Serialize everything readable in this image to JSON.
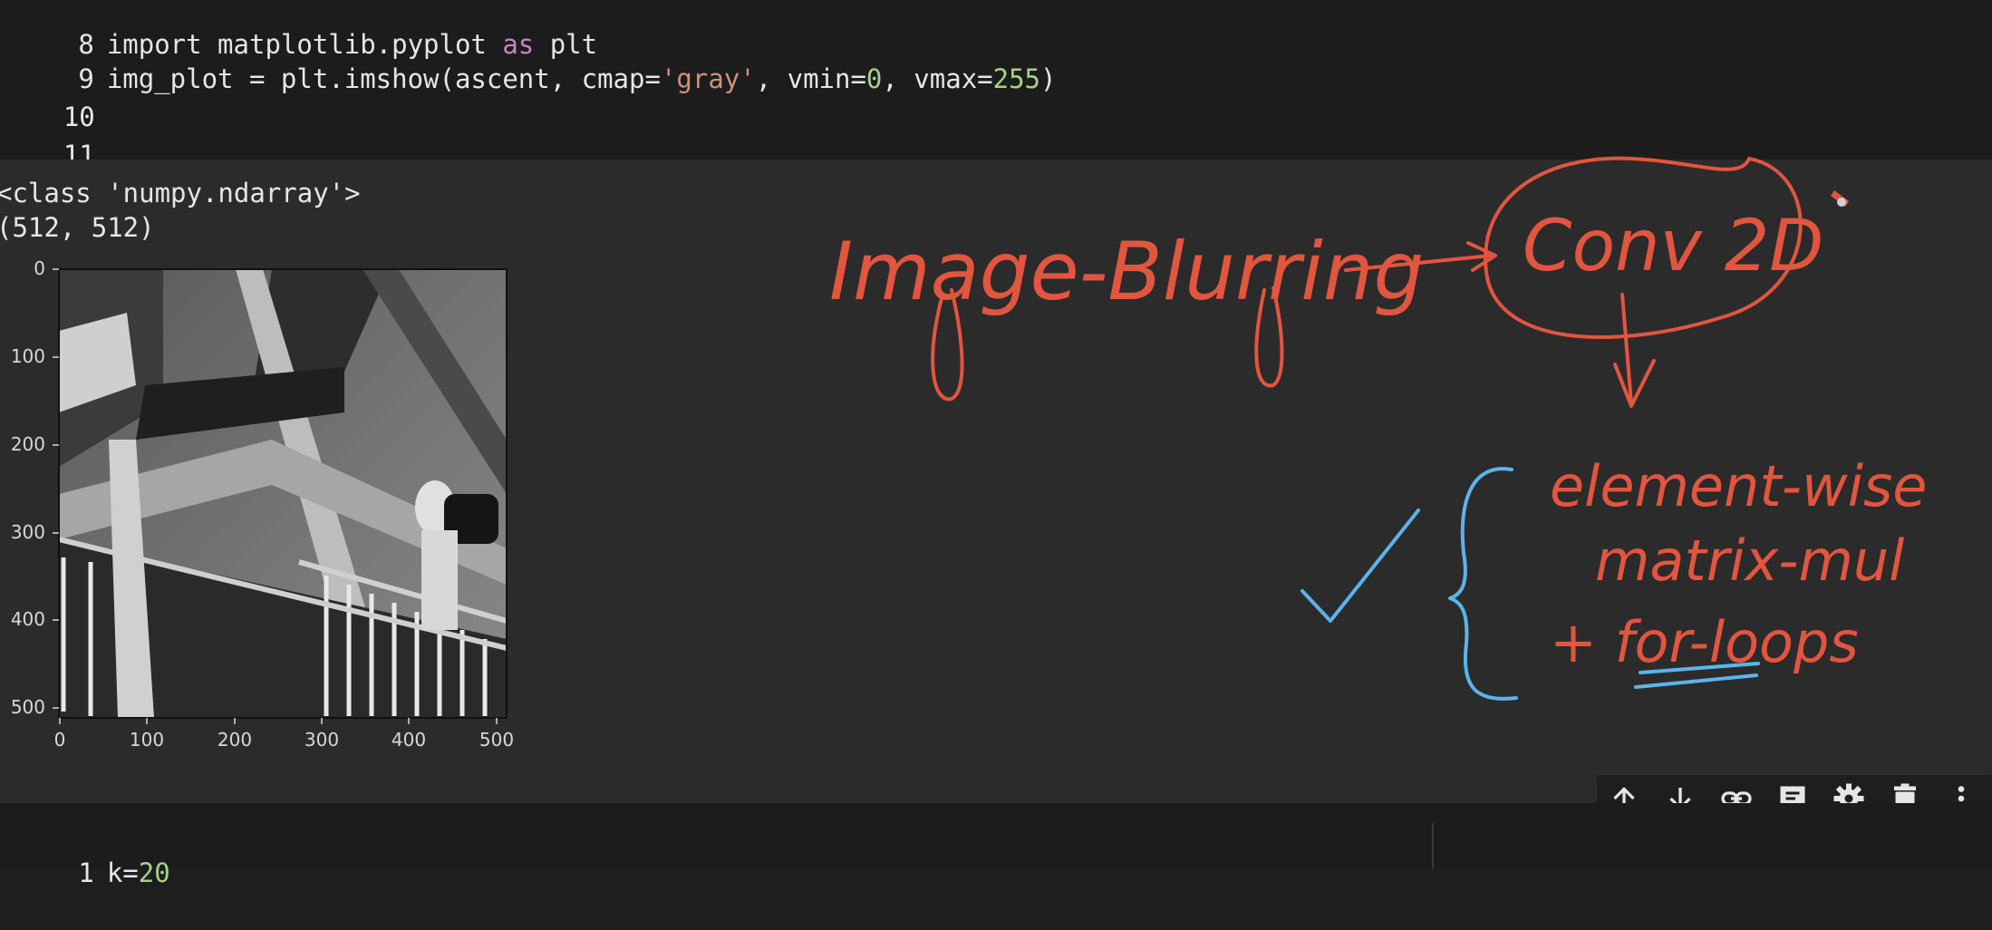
{
  "code_cell": {
    "lines": [
      {
        "num": "8",
        "text_a": "import matplotlib.pyplot ",
        "text_b": "as",
        "text_c": " plt"
      },
      {
        "num": "9",
        "text_a": "img_plot = plt.imshow(ascent, cmap=",
        "str": "'gray'",
        "text_b": ", vmin=",
        "n1": "0",
        "text_c": ", vmax=",
        "n2": "255",
        "text_d": ")"
      },
      {
        "num": "10"
      },
      {
        "num": "11"
      }
    ]
  },
  "output": {
    "line1": "<class 'numpy.ndarray'>",
    "line2": "(512, 512)"
  },
  "plot": {
    "yticks": [
      "0",
      "100",
      "200",
      "300",
      "400",
      "500"
    ],
    "xticks": [
      "0",
      "100",
      "200",
      "300",
      "400",
      "500"
    ],
    "image_desc_icon": "grayscale-staircase-image"
  },
  "annotations": {
    "image_blurring": "Image-Blurring",
    "conv2d": "Conv 2D",
    "element_wise": "element-wise",
    "matrix_mul": "matrix-mul",
    "for_loops": "+ for-loops",
    "ink_color": "#e2553f",
    "blue_ink": "#5bb4ea"
  },
  "toolbar": {
    "icons": [
      "arrow-up-icon",
      "arrow-down-icon",
      "link-icon",
      "comment-icon",
      "gear-icon",
      "trash-icon",
      "more-vert-icon"
    ]
  },
  "next_cell": {
    "num": "1",
    "code": "k=",
    "value": "20"
  }
}
